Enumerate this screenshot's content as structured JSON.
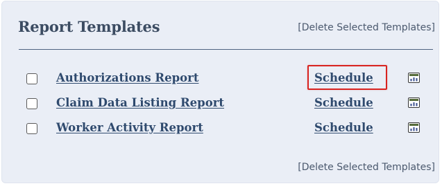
{
  "header": {
    "title": "Report Templates",
    "delete_top": "[Delete Selected Templates]"
  },
  "reports": [
    {
      "name": "Authorizations Report",
      "schedule_label": "Schedule",
      "highlighted": true,
      "checked": false,
      "icon": "report-chart-icon"
    },
    {
      "name": "Claim Data Listing Report",
      "schedule_label": "Schedule",
      "highlighted": false,
      "checked": false,
      "icon": "report-chart-icon"
    },
    {
      "name": "Worker Activity Report",
      "schedule_label": "Schedule",
      "highlighted": false,
      "checked": false,
      "icon": "report-chart-icon"
    }
  ],
  "footer": {
    "delete_bottom": "[Delete Selected Templates]"
  },
  "colors": {
    "panel_background": "#eaeef6",
    "link": "#2f4a6e",
    "highlight": "#d8231f",
    "title": "#3c4c62"
  }
}
